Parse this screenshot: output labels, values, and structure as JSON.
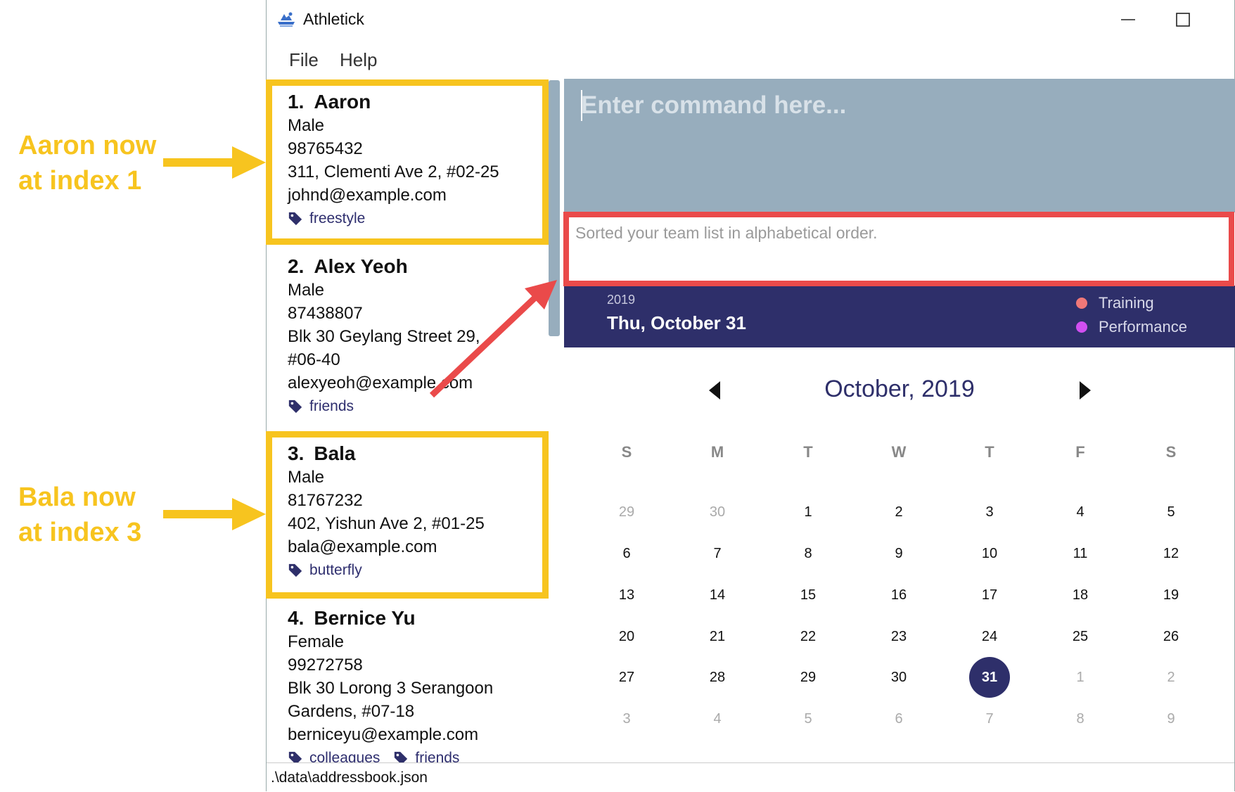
{
  "annotations": {
    "top_line1": "Aaron now",
    "top_line2": "at index 1",
    "bottom_line1": "Bala now",
    "bottom_line2": "at index 3",
    "highlight_color": "#f7c41f",
    "result_highlight_color": "#ea4a4a"
  },
  "window": {
    "title": "Athletick",
    "icon": "athletick-logo-icon",
    "controls": [
      "minimize-icon",
      "maximize-icon",
      "close-icon"
    ]
  },
  "menu": {
    "file": "File",
    "help": "Help"
  },
  "persons": [
    {
      "index": "1.",
      "name": "Aaron",
      "gender": "Male",
      "phone": "98765432",
      "address_lines": [
        "311, Clementi Ave 2, #02-25"
      ],
      "email": "johnd@example.com",
      "tags": [
        "freestyle"
      ]
    },
    {
      "index": "2.",
      "name": "Alex Yeoh",
      "gender": "Male",
      "phone": "87438807",
      "address_lines": [
        "Blk 30 Geylang Street 29,",
        "#06-40"
      ],
      "email": "alexyeoh@example.com",
      "tags": [
        "friends"
      ]
    },
    {
      "index": "3.",
      "name": "Bala",
      "gender": "Male",
      "phone": "81767232",
      "address_lines": [
        "402, Yishun Ave 2, #01-25"
      ],
      "email": "bala@example.com",
      "tags": [
        "butterfly"
      ]
    },
    {
      "index": "4.",
      "name": "Bernice Yu",
      "gender": "Female",
      "phone": "99272758",
      "address_lines": [
        "Blk 30 Lorong 3 Serangoon",
        "Gardens, #07-18"
      ],
      "email": "berniceyu@example.com",
      "tags": [
        "colleagues",
        "friends"
      ]
    }
  ],
  "command": {
    "placeholder": "Enter command here..."
  },
  "result": {
    "text": "Sorted your team list in alphabetical order."
  },
  "date_header": {
    "year": "2019",
    "date": "Thu, October 31",
    "legend": [
      {
        "label": "Training",
        "color": "#f07878"
      },
      {
        "label": "Performance",
        "color": "#d04ff0"
      }
    ]
  },
  "calendar": {
    "title": "October, 2019",
    "days_of_week": [
      "S",
      "M",
      "T",
      "W",
      "T",
      "F",
      "S"
    ],
    "weeks": [
      [
        "29",
        "30",
        "1",
        "2",
        "3",
        "4",
        "5"
      ],
      [
        "6",
        "7",
        "8",
        "9",
        "10",
        "11",
        "12"
      ],
      [
        "13",
        "14",
        "15",
        "16",
        "17",
        "18",
        "19"
      ],
      [
        "20",
        "21",
        "22",
        "23",
        "24",
        "25",
        "26"
      ],
      [
        "27",
        "28",
        "29",
        "30",
        "31",
        "1",
        "2"
      ],
      [
        "3",
        "4",
        "5",
        "6",
        "7",
        "8",
        "9"
      ]
    ],
    "selected_day": "31"
  },
  "status": {
    "path": ".\\data\\addressbook.json"
  }
}
